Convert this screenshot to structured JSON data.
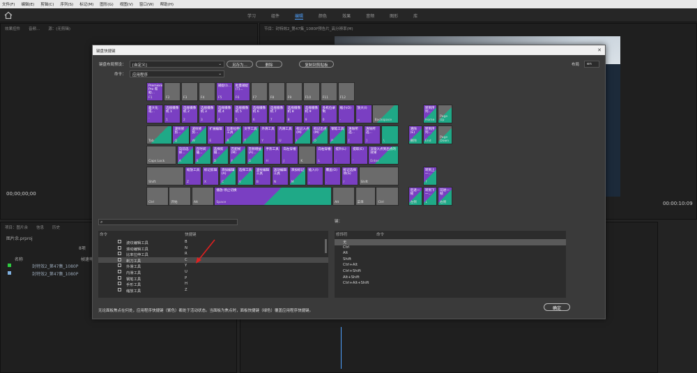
{
  "menu": [
    "文件(F)",
    "编辑(E)",
    "剪辑(C)",
    "序列(S)",
    "标记(M)",
    "图形(G)",
    "视图(V)",
    "窗口(W)",
    "帮助(H)"
  ],
  "workspaces": [
    "学习",
    "组件",
    "编辑",
    "颜色",
    "效果",
    "音频",
    "图形",
    "库"
  ],
  "active_workspace": "编辑",
  "left_panel_tabs": [
    "效果控件",
    "音频...",
    "源：(无剪辑)"
  ],
  "program_tab": "节目：封特效2_第47集_1080P预告片_高分辨率(M)",
  "source_timecode": "00;00;00;00",
  "program_timecode": "00:00:10:09",
  "project": {
    "tabs": [
      "项目：图片余",
      "信息",
      "历史"
    ],
    "file": "图片余.prproj",
    "name_col": "名称",
    "fps_col": "帧速率",
    "items": [
      "封特效2_第47集_1080P",
      "封特效2_第47集_1080P"
    ],
    "count": "8项"
  },
  "dialog": {
    "title": "键盘快捷键",
    "preset_label": "键盘布局预设：",
    "preset_value": "[自定义]",
    "save_as": "另存为...",
    "delete": "删除",
    "copy_to_clipboard": "复制到剪贴板",
    "layout_label": "布局",
    "layout_value": "en",
    "command_label": "命令：",
    "command_value": "应用程序",
    "search_placeholder": "",
    "cmd_header": "命令",
    "shortcut_header": "快捷键",
    "key_label": "键：",
    "mod_header": "修饰符",
    "mod_cmd_header": "命令",
    "commands": [
      {
        "name": "波纹编辑工具",
        "key": "B"
      },
      {
        "name": "滚动编辑工具",
        "key": "N"
      },
      {
        "name": "比率拉伸工具",
        "key": "R"
      },
      {
        "name": "剃刀工具",
        "key": "C"
      },
      {
        "name": "外滑工具",
        "key": "Y"
      },
      {
        "name": "内滑工具",
        "key": "U"
      },
      {
        "name": "钢笔工具",
        "key": "P"
      },
      {
        "name": "手形工具",
        "key": "H"
      },
      {
        "name": "缩放工具",
        "key": "Z"
      }
    ],
    "modifiers": [
      "无",
      "Ctrl",
      "Alt",
      "Shift",
      "Ctrl+Alt",
      "Ctrl+Shift",
      "Alt+Shift",
      "Ctrl+Alt+Shift"
    ],
    "note": "无论面板焦点在何处，应用程序快捷键（紫色）都处于活动状态。当面板为焦点时，面板快捷键（绿色）覆盖应用程序快捷键。",
    "ok": "确定"
  },
  "keys": {
    "f1": {
      "top": "Premiere Pro 帮助...",
      "lbl": "F1"
    },
    "f2": {
      "top": "",
      "lbl": "F2"
    },
    "f3": {
      "top": "",
      "lbl": "F3"
    },
    "f4": {
      "top": "",
      "lbl": "F4"
    },
    "f5": {
      "top": "捕捉(I)...",
      "lbl": "F5"
    },
    "f6": {
      "top": "批量捕捉(T)...",
      "lbl": "F6"
    },
    "f7": {
      "top": "",
      "lbl": "F7"
    },
    "f8": {
      "top": "",
      "lbl": "F8"
    },
    "f9": {
      "top": "",
      "lbl": "F9"
    },
    "f10": {
      "top": "",
      "lbl": "F10"
    },
    "f11": {
      "top": "",
      "lbl": "F11"
    },
    "f12": {
      "top": "",
      "lbl": "F12"
    },
    "grave": {
      "top": "最大化或...",
      "lbl": "`"
    },
    "n1": {
      "top": "选择摄像机 1",
      "lbl": "1"
    },
    "n2": {
      "top": "选择摄像机 2",
      "lbl": "2"
    },
    "n3": {
      "top": "选择摄像机 3",
      "lbl": "3"
    },
    "n4": {
      "top": "选择摄像机 4",
      "lbl": "4"
    },
    "n5": {
      "top": "选择摄像机 5",
      "lbl": "5"
    },
    "n6": {
      "top": "选择摄像机 6",
      "lbl": "6"
    },
    "n7": {
      "top": "选择摄像机 7",
      "lbl": "7"
    },
    "n8": {
      "top": "选择摄像机 8",
      "lbl": "8"
    },
    "n9": {
      "top": "选择摄像机 9",
      "lbl": "9"
    },
    "n0": {
      "top": "多机位录制",
      "lbl": "0"
    },
    "minus": {
      "top": "缩小(O)",
      "lbl": "-"
    },
    "equal": {
      "top": "放大(I)",
      "lbl": "="
    },
    "bksp": {
      "top": "",
      "lbl": "Backspace"
    },
    "home": {
      "top": "转到序列...",
      "lbl": "Home"
    },
    "pgup": {
      "top": "",
      "lbl": "Page Up"
    },
    "tab": {
      "top": "",
      "lbl": "Tab"
    },
    "q": {
      "top": "波纹修剪...",
      "lbl": "Q"
    },
    "w": {
      "top": "波纹修剪...",
      "lbl": "W"
    },
    "e": {
      "top": "扩展编辑",
      "lbl": "E"
    },
    "r": {
      "top": "比率拉伸工具",
      "lbl": "R"
    },
    "t": {
      "top": "文字工具",
      "lbl": "T"
    },
    "y": {
      "top": "外滑工具",
      "lbl": "Y"
    },
    "u": {
      "top": "内滑工具",
      "lbl": "U"
    },
    "i": {
      "top": "标记入点(M)",
      "lbl": "I"
    },
    "o": {
      "top": "标记出点(M)",
      "lbl": "O"
    },
    "p": {
      "top": "钢笔工具",
      "lbl": "P"
    },
    "lbr": {
      "top": "清除所选...",
      "lbl": "["
    },
    "rbr": {
      "top": "清除所选...",
      "lbl": "]"
    },
    "bslash": {
      "top": "",
      "lbl": "\\"
    },
    "del": {
      "top": "清除(E)",
      "lbl": "删除"
    },
    "end": {
      "top": "转到序列...",
      "lbl": "End"
    },
    "pgdn": {
      "top": "",
      "lbl": "Page Down"
    },
    "caps": {
      "top": "",
      "lbl": "Caps Lock"
    },
    "a": {
      "top": "向前选择...",
      "lbl": "A"
    },
    "s": {
      "top": "在时间轴...",
      "lbl": "S"
    },
    "d": {
      "top": "选择剪辑...",
      "lbl": "D"
    },
    "f": {
      "top": "匹配帧(M)",
      "lbl": "F"
    },
    "g": {
      "top": "音频增益(A)...",
      "lbl": "G"
    },
    "h": {
      "top": "手形工具",
      "lbl": "H"
    },
    "j": {
      "top": "向左穿梭",
      "lbl": "J"
    },
    "k": {
      "top": "",
      "lbl": "K"
    },
    "l": {
      "top": "向右穿梭",
      "lbl": "L"
    },
    "semi": {
      "top": "提升(L)",
      "lbl": ";"
    },
    "quote": {
      "top": "提取(E)",
      "lbl": "'"
    },
    "enter": {
      "top": "渲染入点到出点的效果",
      "lbl": "Enter"
    },
    "lshift": {
      "top": "",
      "lbl": "Shift"
    },
    "z": {
      "top": "缩放工具",
      "lbl": "Z"
    },
    "x": {
      "top": "标记剪辑",
      "lbl": "X"
    },
    "c": {
      "top": "添加编辑(A)",
      "lbl": "C"
    },
    "v": {
      "top": "选择工具",
      "lbl": "V"
    },
    "b": {
      "top": "波纹编辑工具",
      "lbl": "B"
    },
    "n": {
      "top": "滚动编辑工具",
      "lbl": "N"
    },
    "m": {
      "top": "添加标记",
      "lbl": "M"
    },
    "comma": {
      "top": "插入(I)",
      "lbl": ","
    },
    "period": {
      "top": "覆盖(O)",
      "lbl": "."
    },
    "slash": {
      "top": "标记选择项(S)",
      "lbl": "/"
    },
    "rshift": {
      "top": "",
      "lbl": "Shift"
    },
    "up": {
      "top": "转到上一...",
      "lbl": "↑"
    },
    "lctrl": {
      "top": "",
      "lbl": "Ctrl"
    },
    "win": {
      "top": "",
      "lbl": "开始"
    },
    "lalt": {
      "top": "",
      "lbl": "Alt"
    },
    "space": {
      "top": "播放-停止切换",
      "lbl": "Space"
    },
    "ralt": {
      "top": "",
      "lbl": "Alt"
    },
    "menu": {
      "top": "",
      "lbl": "菜单"
    },
    "rctrl": {
      "top": "",
      "lbl": "Ctrl"
    },
    "left": {
      "top": "后退一帧",
      "lbl": "左侧"
    },
    "down": {
      "top": "转到下一...",
      "lbl": "↓"
    },
    "right": {
      "top": "前进一帧",
      "lbl": "右侧"
    }
  },
  "colors": {
    "app_shortcut": "#7a3fc2",
    "panel_shortcut": "#1fa987",
    "unassigned": "#6b6b6b",
    "accent": "#4ea1ff",
    "arrow": "#e02020"
  }
}
